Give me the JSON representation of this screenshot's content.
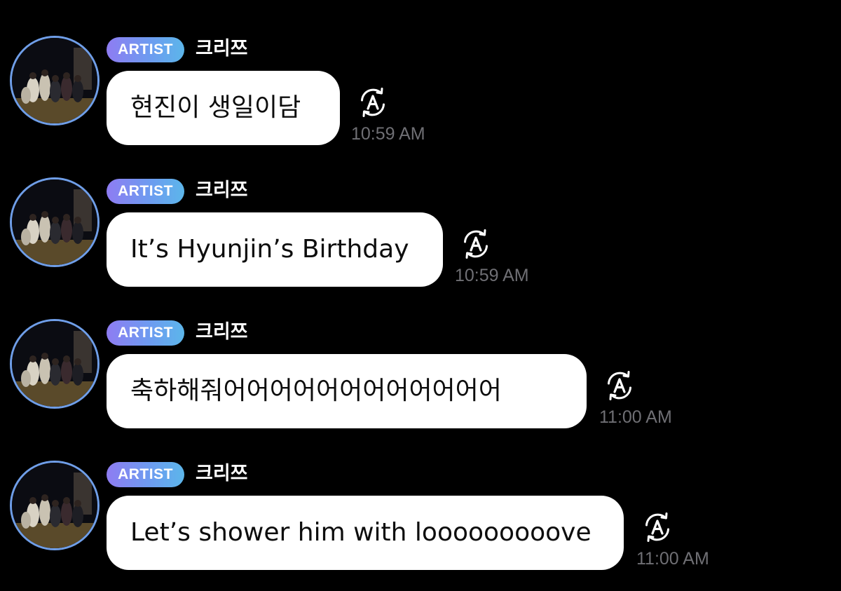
{
  "messages": [
    {
      "badge": "ARTIST",
      "sender": "크리쯔",
      "text": "현진이 생일이담",
      "time": "10:59 AM",
      "translate_icon": "auto-translate-icon"
    },
    {
      "badge": "ARTIST",
      "sender": "크리쯔",
      "text": "It’s Hyunjin’s Birthday",
      "time": "10:59 AM",
      "translate_icon": "auto-translate-icon"
    },
    {
      "badge": "ARTIST",
      "sender": "크리쯔",
      "text": "축하해줘어어어어어어어어어어어어",
      "time": "11:00 AM",
      "translate_icon": "auto-translate-icon"
    },
    {
      "badge": "ARTIST",
      "sender": "크리쯔",
      "text": "Let’s shower him with looooooooove",
      "time": "11:00 AM",
      "translate_icon": "auto-translate-icon"
    }
  ],
  "colors": {
    "background": "#000000",
    "bubble": "#ffffff",
    "bubble_text": "#0d0d0d",
    "timestamp": "#6f6f74",
    "badge_gradient_start": "#8e7cf2",
    "badge_gradient_end": "#5cb6ea",
    "avatar_ring": "#6f9ee8"
  }
}
